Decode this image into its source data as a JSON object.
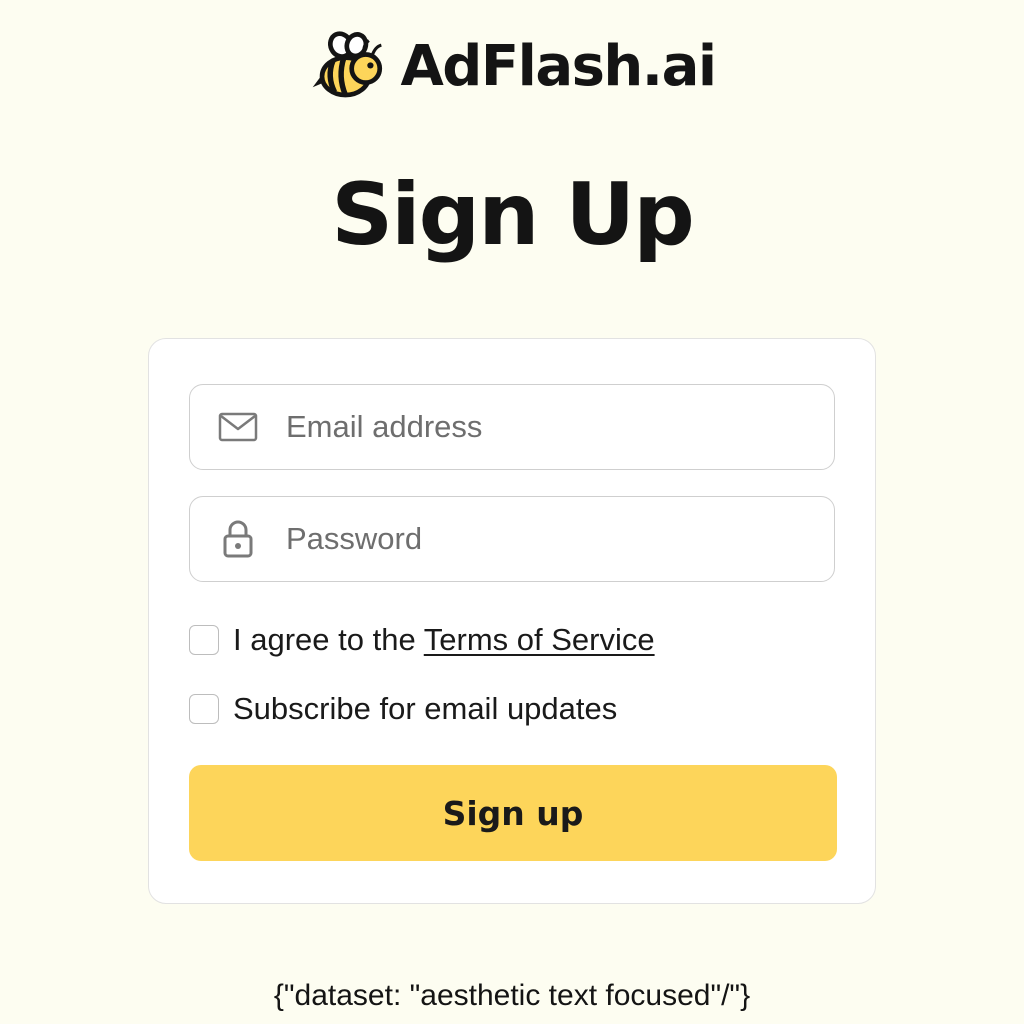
{
  "brand": {
    "name": "AdFlash.ai",
    "logo_icon": "bee-icon"
  },
  "page": {
    "title": "Sign Up"
  },
  "form": {
    "email": {
      "icon": "mail-icon",
      "placeholder": "Email address",
      "value": ""
    },
    "password": {
      "icon": "lock-icon",
      "placeholder": "Password",
      "value": ""
    },
    "terms": {
      "checked": false,
      "prefix": "I agree to the ",
      "link_text": "Terms of Service"
    },
    "subscribe": {
      "checked": false,
      "label": "Subscribe for email updates"
    },
    "submit_label": "Sign up"
  },
  "footer": {
    "note": "{\"dataset: \"aesthetic text focused\"/\"}"
  },
  "colors": {
    "background": "#fdfdf1",
    "accent": "#fdd55a",
    "text": "#141414"
  }
}
